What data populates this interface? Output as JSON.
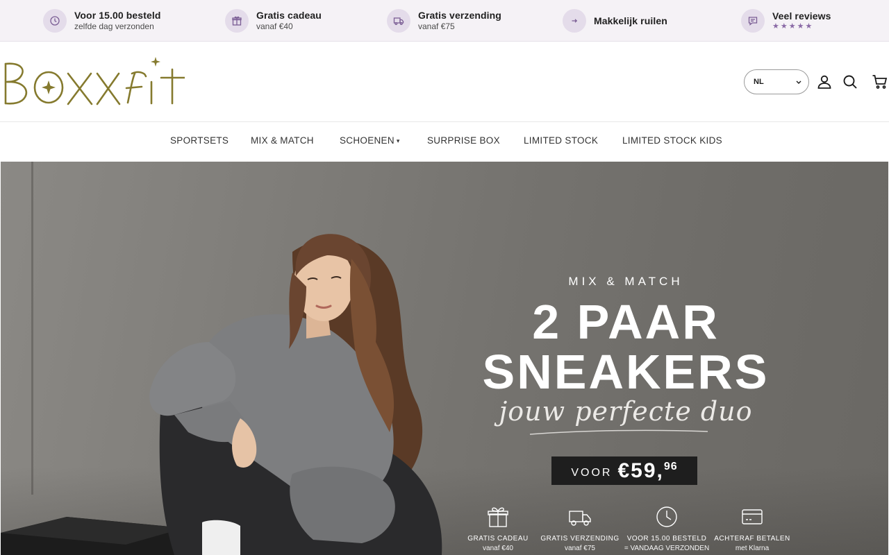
{
  "usp_bar": {
    "items": [
      {
        "title": "Voor 15.00 besteld",
        "sub": "zelfde dag verzonden",
        "icon": "clock-icon"
      },
      {
        "title": "Gratis cadeau",
        "sub": "vanaf €40",
        "icon": "gift-icon"
      },
      {
        "title": "Gratis verzending",
        "sub": "vanaf €75",
        "icon": "truck-icon"
      },
      {
        "title": "Makkelijk ruilen",
        "sub": "",
        "icon": "arrow-right-icon"
      },
      {
        "title": "Veel reviews",
        "stars": "★★★★★",
        "icon": "chat-icon"
      }
    ]
  },
  "header": {
    "language": "NL",
    "icons": [
      "account-icon",
      "search-icon",
      "cart-icon"
    ]
  },
  "nav": {
    "items": [
      {
        "label": "SPORTSETS"
      },
      {
        "label": "MIX & MATCH"
      },
      {
        "label": "SCHOENEN",
        "caret": "▾"
      },
      {
        "label": "SURPRISE BOX"
      },
      {
        "label": "LIMITED STOCK"
      },
      {
        "label": "LIMITED STOCK KIDS"
      }
    ]
  },
  "hero": {
    "eyebrow": "MIX & MATCH",
    "title_line1": "2 PAAR",
    "title_line2": "SNEAKERS",
    "script": "jouw perfecte duo",
    "price_prefix": "VOOR",
    "price_main": "€59,",
    "price_cents": "96",
    "features": [
      {
        "title": "GRATIS CADEAU",
        "sub": "vanaf €40",
        "icon": "gift-icon"
      },
      {
        "title": "GRATIS VERZENDING",
        "sub": "vanaf €75",
        "icon": "truck-icon"
      },
      {
        "title": "VOOR 15.00 BESTELD",
        "sub": "= VANDAAG VERZONDEN",
        "icon": "clock-icon"
      },
      {
        "title": "ACHTERAF BETALEN",
        "sub": "met Klarna",
        "icon": "credit-card-icon"
      }
    ]
  },
  "colors": {
    "brand_gold": "#857a2e",
    "usp_bg": "#f5f2f6",
    "usp_icon_bg": "#e4dcea",
    "usp_icon": "#7a5d94"
  }
}
